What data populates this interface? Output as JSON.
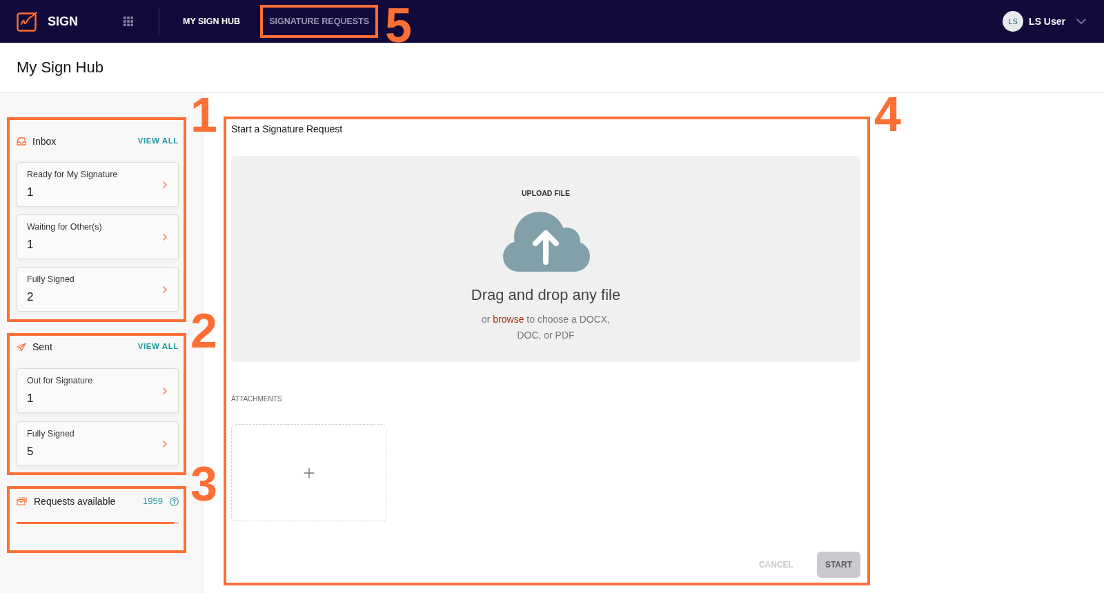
{
  "navbar": {
    "brand": "SIGN",
    "links": [
      {
        "label": "MY SIGN HUB",
        "selected": true
      },
      {
        "label": "SIGNATURE REQUESTS",
        "selected": false,
        "callout": "5"
      }
    ],
    "user": {
      "initials": "LS",
      "name": "LS User"
    }
  },
  "page_title": "My Sign Hub",
  "sidebar": {
    "inbox": {
      "callout": "1",
      "title": "Inbox",
      "view_all": "VIEW ALL",
      "items": [
        {
          "label": "Ready for My Signature",
          "count": "1"
        },
        {
          "label": "Waiting for Other(s)",
          "count": "1"
        },
        {
          "label": "Fully Signed",
          "count": "2"
        }
      ]
    },
    "sent": {
      "callout": "2",
      "title": "Sent",
      "view_all": "VIEW ALL",
      "items": [
        {
          "label": "Out for Signature",
          "count": "1"
        },
        {
          "label": "Fully Signed",
          "count": "5"
        }
      ]
    },
    "requests": {
      "callout": "3",
      "label": "Requests available",
      "count": "1959",
      "level": 0.97
    }
  },
  "signature_request": {
    "callout": "4",
    "title": "Start a Signature Request",
    "upload": {
      "label": "UPLOAD FILE",
      "heading": "Drag and drop any file",
      "hint_before": "or",
      "link": "browse",
      "hint_after": "to choose a DOCX, DOC, or PDF"
    },
    "attachments_label": "ATTACHMENTS",
    "buttons": [
      {
        "label": "CANCEL",
        "kind": "text",
        "disabled": true
      },
      {
        "label": "START",
        "kind": "filled",
        "disabled": true
      }
    ]
  }
}
